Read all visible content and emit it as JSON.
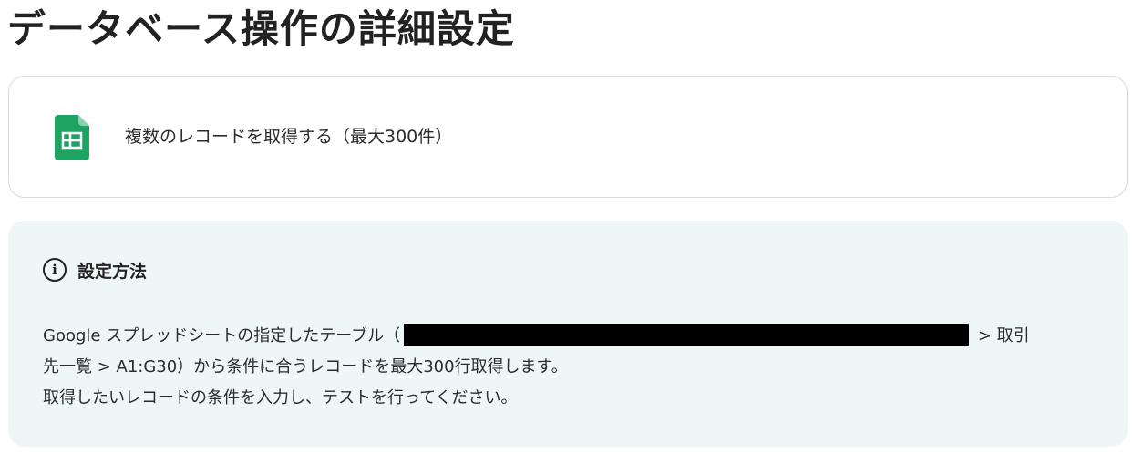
{
  "page": {
    "title": "データベース操作の詳細設定"
  },
  "action": {
    "icon": "google-sheets-icon",
    "label": "複数のレコードを取得する（最大300件）"
  },
  "info": {
    "icon": "info-circle-icon",
    "title": "設定方法",
    "line1_prefix": "Google スプレッドシートの指定したテーブル（",
    "line1_suffix": " > 取引",
    "line2": "先一覧 > A1:G30）から条件に合うレコードを最大300行取得します。",
    "line3": "取得したいレコードの条件を入力し、テストを行ってください。"
  },
  "colors": {
    "sheets_green": "#1ea362",
    "panel_bg": "#eef7f6"
  }
}
